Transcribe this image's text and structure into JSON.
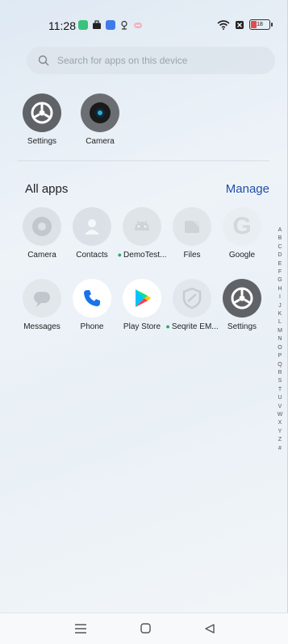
{
  "status_bar": {
    "time": "11:28",
    "battery_level": "18"
  },
  "search": {
    "placeholder": "Search for apps on this device"
  },
  "suggested_apps": [
    {
      "label": "Settings",
      "icon": "settings-icon"
    },
    {
      "label": "Camera",
      "icon": "camera-icon"
    }
  ],
  "all_apps": {
    "title": "All apps",
    "manage_label": "Manage",
    "apps": [
      {
        "label": "Camera",
        "icon": "camera-icon",
        "faded": true,
        "new_dot": false
      },
      {
        "label": "Contacts",
        "icon": "contacts-icon",
        "faded": true,
        "new_dot": false
      },
      {
        "label": "DemoTest...",
        "icon": "android-icon",
        "faded": true,
        "new_dot": true
      },
      {
        "label": "Files",
        "icon": "files-icon",
        "faded": true,
        "new_dot": false
      },
      {
        "label": "Google",
        "icon": "google-icon",
        "faded": true,
        "new_dot": false
      },
      {
        "label": "Messages",
        "icon": "messages-icon",
        "faded": true,
        "new_dot": false
      },
      {
        "label": "Phone",
        "icon": "phone-icon",
        "faded": false,
        "new_dot": false
      },
      {
        "label": "Play Store",
        "icon": "play-store-icon",
        "faded": false,
        "new_dot": false
      },
      {
        "label": "Seqrite EM...",
        "icon": "seqrite-icon",
        "faded": true,
        "new_dot": true
      },
      {
        "label": "Settings",
        "icon": "settings-icon",
        "faded": false,
        "new_dot": false
      }
    ]
  },
  "alphabet_index": [
    "A",
    "B",
    "C",
    "D",
    "E",
    "F",
    "G",
    "H",
    "I",
    "J",
    "K",
    "L",
    "M",
    "N",
    "O",
    "P",
    "Q",
    "R",
    "S",
    "T",
    "U",
    "V",
    "W",
    "X",
    "Y",
    "Z",
    "#"
  ],
  "colors": {
    "manage_link": "#1f4fa8",
    "new_dot": "#2aa76d",
    "settings_icon_bg": "#5f6368"
  }
}
